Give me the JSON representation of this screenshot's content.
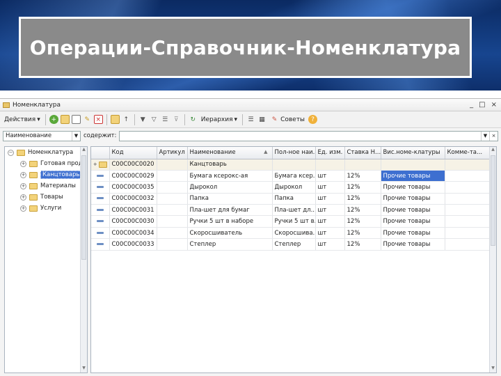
{
  "slide": {
    "title": "Операции-Справочник-Номенклатура"
  },
  "window": {
    "title": "Номенклатура",
    "controls": {
      "minimize": "_",
      "restore": "□",
      "close": "×"
    }
  },
  "toolbar": {
    "actions_label": "Действия",
    "hierarchy_label": "Иерархия",
    "help_label": "Советы"
  },
  "filter": {
    "field_value": "Наименование",
    "contains_label": "содержит:",
    "search_value": ""
  },
  "tree": {
    "root": "Номенклатура",
    "items": [
      {
        "label": "Готовая прод",
        "selected": false
      },
      {
        "label": "Канцтоварь",
        "selected": true
      },
      {
        "label": "Материалы",
        "selected": false
      },
      {
        "label": "Товары",
        "selected": false
      },
      {
        "label": "Услуги",
        "selected": false
      }
    ]
  },
  "grid": {
    "columns": [
      "Код",
      "Артикул",
      "Наименование",
      "Пол-ное наи...",
      "Ед. изм.",
      "Ставка Н...",
      "Вис.номе-клатуры",
      "Комме-та..."
    ],
    "rows": [
      {
        "type": "group",
        "code": "С00С00С0020",
        "article": "",
        "name": "Канцтоварь",
        "full_name": "",
        "unit": "",
        "vat": "",
        "kind": "",
        "comment": ""
      },
      {
        "type": "item",
        "code": "С00С00С0029",
        "article": "",
        "name": "Бумага ксерокс-ая",
        "full_name": "Бумага ксер...",
        "unit": "шт",
        "vat": "12%",
        "kind": "Прочие товары",
        "comment": ""
      },
      {
        "type": "item",
        "code": "С00С00С0035",
        "article": "",
        "name": "Дырокол",
        "full_name": "Дырокол",
        "unit": "шт",
        "vat": "12%",
        "kind": "Прочие товары",
        "comment": ""
      },
      {
        "type": "item",
        "code": "С00С00С0032",
        "article": "",
        "name": "Папка",
        "full_name": "Папка",
        "unit": "шт",
        "vat": "12%",
        "kind": "Прочие товары",
        "comment": ""
      },
      {
        "type": "item",
        "code": "С00С00С0031",
        "article": "",
        "name": "Пла-шет для бумаг",
        "full_name": "Пла-шет дл...",
        "unit": "шт",
        "vat": "12%",
        "kind": "Прочие товары",
        "comment": ""
      },
      {
        "type": "item",
        "code": "С00С00С0030",
        "article": "",
        "name": "Ручки 5 шт в наборе",
        "full_name": "Ручки 5 шт в...",
        "unit": "шт",
        "vat": "12%",
        "kind": "Прочие товары",
        "comment": ""
      },
      {
        "type": "item",
        "code": "С00С00С0034",
        "article": "",
        "name": "Скоросшиватель",
        "full_name": "Скоросшива...",
        "unit": "шт",
        "vat": "12%",
        "kind": "Прочие товары",
        "comment": ""
      },
      {
        "type": "item",
        "code": "С00С00С0033",
        "article": "",
        "name": "Степлер",
        "full_name": "Степлер",
        "unit": "шт",
        "vat": "12%",
        "kind": "Прочие товары",
        "comment": ""
      }
    ]
  }
}
